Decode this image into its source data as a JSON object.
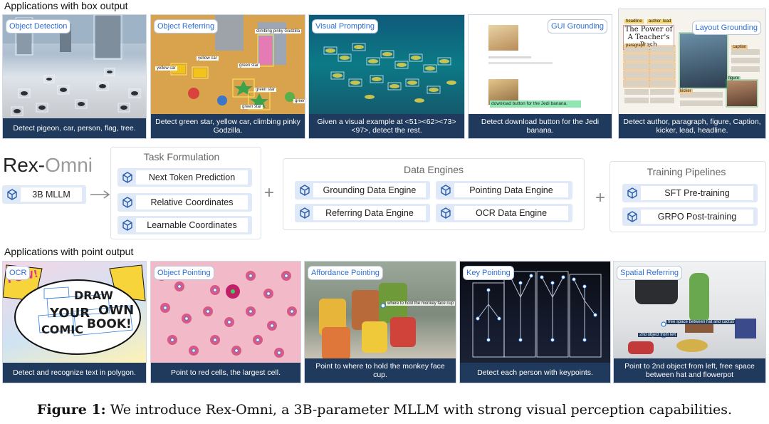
{
  "box_section_title": "Applications with box output",
  "point_section_title": "Applications with point output",
  "box_apps": [
    {
      "tag": "Object Detection",
      "caption": "Detect pigeon, car, person, flag, tree."
    },
    {
      "tag": "Object Referring",
      "caption": "Detect green star, yellow car, climbing pinky Godzilla."
    },
    {
      "tag": "Visual Prompting",
      "caption": "Given a visual example at <51><62><73><97>, detect the rest."
    },
    {
      "tag": "GUI Grounding",
      "caption": "Detect download button for the Jedi banana."
    },
    {
      "tag": "Layout Grounding",
      "caption": "Detect author, paragraph, figure, Caption, kicker, lead, headline."
    }
  ],
  "point_apps": [
    {
      "tag": "OCR",
      "caption": "Detect and recognize text in polygon."
    },
    {
      "tag": "Object Pointing",
      "caption": "Point to red cells, the largest cell."
    },
    {
      "tag": "Affordance Pointing",
      "caption": "Point to where to hold the monkey face cup."
    },
    {
      "tag": "Key Pointing",
      "caption": "Detect each person with keypoints."
    },
    {
      "tag": "Spatial Referring",
      "caption": "Point to 2nd object from left, free space between hat and flowerpot"
    }
  ],
  "scene_text": {
    "referring_labels": [
      "climbing pinky Godzilla",
      "yellow car",
      "yellow car",
      "green star",
      "green star",
      "green star",
      "green"
    ],
    "gui_button": "download button for the Jedi banana.",
    "layout_headline": "The Power of A Teacher's Push",
    "layout_labels": [
      "headline",
      "author",
      "paragraph",
      "figure",
      "caption",
      "kicker",
      "lead"
    ],
    "comic_words": [
      "POW!",
      "DRAW",
      "YOUR",
      "OWN",
      "COMIC",
      "BOOK!"
    ],
    "affordance_label": "where to hold the monkey face cup",
    "spatial_labels": [
      "free space between hat and cactus",
      "2nd object from left"
    ]
  },
  "model": {
    "name_part1": "Rex-",
    "name_part2": "Omni",
    "base": "3B MLLM"
  },
  "task_formulation": {
    "title": "Task Formulation",
    "items": [
      "Next Token Prediction",
      "Relative Coordinates",
      "Learnable Coordinates"
    ]
  },
  "data_engines": {
    "title": "Data Engines",
    "items": [
      "Grounding Data Engine",
      "Pointing Data Engine",
      "Referring Data Engine",
      "OCR Data Engine"
    ]
  },
  "training_pipelines": {
    "title": "Training Pipelines",
    "items": [
      "SFT Pre-training",
      "GRPO Post-training"
    ]
  },
  "figure_caption": {
    "label": "Figure 1:",
    "text": " We introduce Rex-Omni, a 3B-parameter MLLM with strong visual perception capabilities."
  },
  "colors": {
    "caption_bar": "#1f3a5c",
    "chip_bg": "#dfe9f7",
    "tag_text": "#2f6fd1",
    "model_accent": "#9a9a9a"
  }
}
